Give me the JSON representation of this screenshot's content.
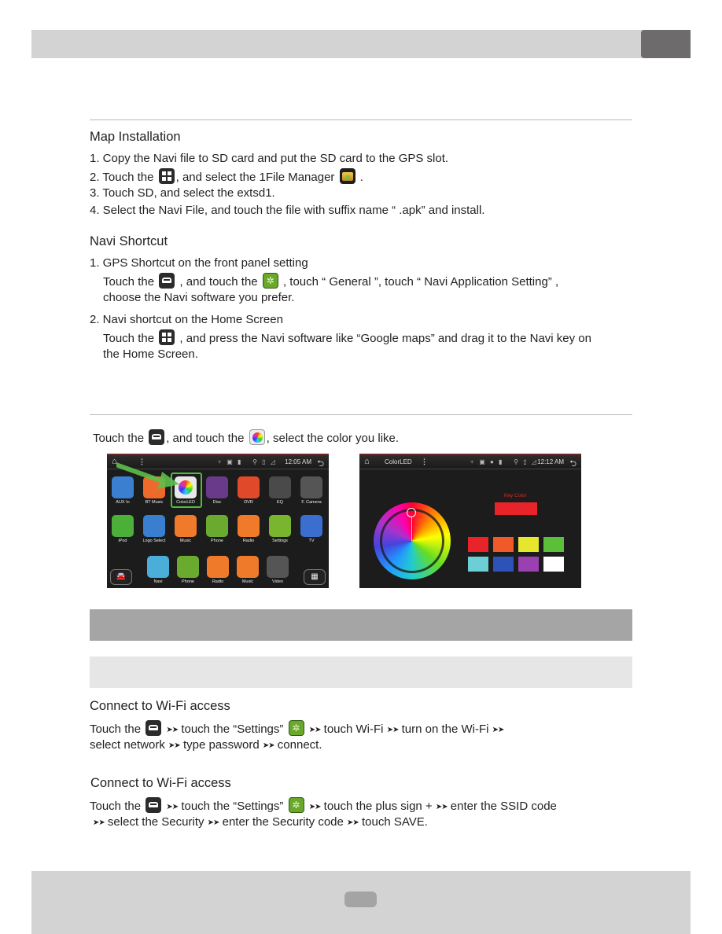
{
  "map_installation": {
    "title": "Map Installation",
    "steps": [
      "1. Copy the Navi file to SD card and put the SD card to the GPS slot.",
      {
        "pre": "2. Touch the ",
        "mid": ", and select the 1File Manager ",
        "post": " ."
      },
      "3. Touch SD, and select the extsd1.",
      "4. Select the Navi File, and touch the file with suffix name “ .apk” and install."
    ]
  },
  "navi_shortcut": {
    "title": "Navi Shortcut",
    "item1_title": "1. GPS Shortcut on the front panel setting",
    "item1_line1": {
      "pre": "Touch the ",
      "mid": " , and touch the ",
      "post": " , touch “ General ”, touch “ Navi Application Setting” ,"
    },
    "item1_line2": "choose the Navi software you prefer.",
    "item2_title": "2. Navi shortcut on the Home Screen",
    "item2_line1": {
      "pre": "Touch the ",
      "post": " , and press the Navi software like “Google maps” and drag it to the Navi key on"
    },
    "item2_line2": "the Home Screen."
  },
  "color_led": {
    "instruction": {
      "pre": "Touch  the ",
      "mid": ", and touch the ",
      "post": ", select the color you like."
    },
    "home_screen": {
      "time": "12:05 AM",
      "apps_row1": [
        "AUX In",
        "BT Music",
        "ColorLED",
        "Disc",
        "DVR",
        "EQ",
        "F. Camera"
      ],
      "apps_row2": [
        "iPod",
        "Logo Select",
        "Music",
        "Phone",
        "Radio",
        "Settings",
        "TV"
      ],
      "dock": [
        "Navi",
        "Phone",
        "Radio",
        "Music",
        "Video"
      ]
    },
    "colorled_screen": {
      "title": "ColorLED",
      "time": "12:12 AM",
      "key_color_label": "Key Color",
      "key_color": "#e8232a",
      "swatches": [
        "#e8232a",
        "#ef5a28",
        "#e6e62e",
        "#5cbf3a",
        "#6ccfd6",
        "#2d52b8",
        "#9a40b0",
        "#ffffff"
      ]
    }
  },
  "wifi1": {
    "title": "Connect to Wi-Fi access",
    "line1": {
      "a": "Touch the ",
      "b": " touch the “Settings” ",
      "c": " touch Wi-Fi ",
      "d": " turn on the Wi-Fi "
    },
    "line2": {
      "a": "select network ",
      "b": " type password  ",
      "c": " connect."
    }
  },
  "wifi2": {
    "title": "Connect to Wi-Fi access",
    "line1": {
      "a": "Touch the ",
      "b": " touch the “Settings” ",
      "c": "  touch the plus sign + ",
      "d": " enter the SSID code"
    },
    "line2": {
      "a": " select the Security ",
      "b": " enter the Security code ",
      "c": " touch SAVE."
    }
  },
  "arrows": "➤➤"
}
